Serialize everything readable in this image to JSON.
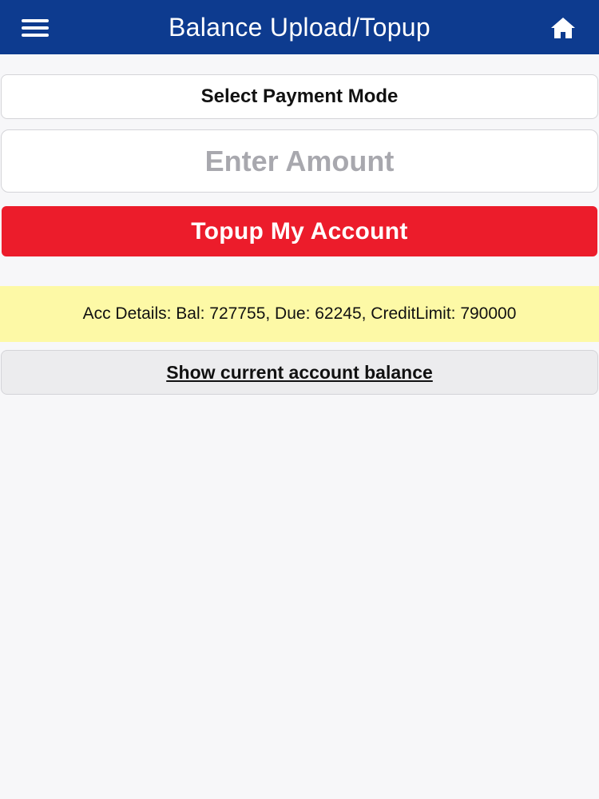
{
  "header": {
    "title": "Balance Upload/Topup",
    "menu_icon": "hamburger-menu-icon",
    "home_icon": "home-icon",
    "background_color": "#0d3b8f"
  },
  "form": {
    "payment_mode_label": "Select Payment Mode",
    "amount_placeholder": "Enter Amount",
    "amount_value": "",
    "topup_button_label": "Topup My Account",
    "topup_button_color": "#ec1c2b"
  },
  "account": {
    "details_text": "Acc Details: Bal: 727755, Due: 62245, CreditLimit: 790000",
    "details_background": "#fdf9a6",
    "show_balance_label": "Show current account balance"
  }
}
